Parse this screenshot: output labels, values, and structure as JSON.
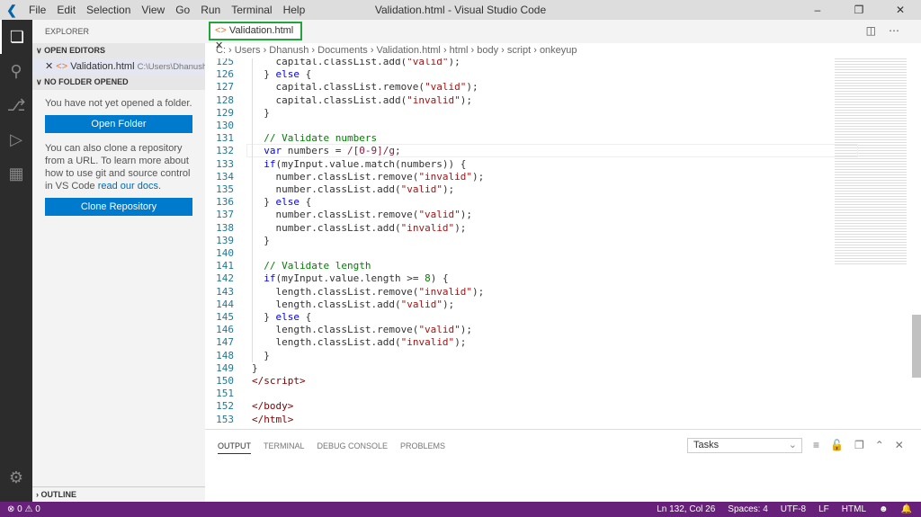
{
  "titlebar": {
    "menu": [
      "File",
      "Edit",
      "Selection",
      "View",
      "Go",
      "Run",
      "Terminal",
      "Help"
    ],
    "title": "Validation.html - Visual Studio Code"
  },
  "sidebar": {
    "header": "EXPLORER",
    "open_editors": "OPEN EDITORS",
    "open_file": "Validation.html",
    "open_file_path": "C:\\Users\\Dhanush\\...",
    "no_folder": "NO FOLDER OPENED",
    "msg1": "You have not yet opened a folder.",
    "open_folder": "Open Folder",
    "msg2": "You can also clone a repository from a URL. To learn more about how to use git and source control in VS Code ",
    "docs_link": "read our docs",
    "msg2_end": ".",
    "clone": "Clone Repository",
    "outline": "OUTLINE"
  },
  "tab": {
    "label": "Validation.html"
  },
  "breadcrumbs": [
    "C:",
    "Users",
    "Dhanush",
    "Documents",
    "Validation.html",
    "html",
    "body",
    "script",
    "onkeyup"
  ],
  "code": {
    "current_line": 132,
    "lines": [
      [
        125,
        [
          [
            "",
            "    capital.classList.add("
          ],
          [
            "s",
            "\"valid\""
          ],
          [
            "",
            ");"
          ]
        ]
      ],
      [
        126,
        [
          [
            "",
            "  } "
          ],
          [
            "k",
            "else"
          ],
          [
            "",
            " {"
          ]
        ]
      ],
      [
        127,
        [
          [
            "",
            "    capital.classList.remove("
          ],
          [
            "s",
            "\"valid\""
          ],
          [
            "",
            ");"
          ]
        ]
      ],
      [
        128,
        [
          [
            "",
            "    capital.classList.add("
          ],
          [
            "s",
            "\"invalid\""
          ],
          [
            "",
            ");"
          ]
        ]
      ],
      [
        129,
        [
          [
            "",
            "  }"
          ]
        ]
      ],
      [
        130,
        []
      ],
      [
        131,
        [
          [
            "c",
            "  // Validate numbers"
          ]
        ]
      ],
      [
        132,
        [
          [
            "k",
            "  var"
          ],
          [
            "",
            " numbers = "
          ],
          [
            "r",
            "/[0-9]/g"
          ],
          [
            "",
            ";"
          ]
        ]
      ],
      [
        133,
        [
          [
            "k",
            "  if"
          ],
          [
            "",
            "(myInput.value.match(numbers)) {"
          ]
        ]
      ],
      [
        134,
        [
          [
            "",
            "    number.classList.remove("
          ],
          [
            "s",
            "\"invalid\""
          ],
          [
            "",
            ");"
          ]
        ]
      ],
      [
        135,
        [
          [
            "",
            "    number.classList.add("
          ],
          [
            "s",
            "\"valid\""
          ],
          [
            "",
            ");"
          ]
        ]
      ],
      [
        136,
        [
          [
            "",
            "  } "
          ],
          [
            "k",
            "else"
          ],
          [
            "",
            " {"
          ]
        ]
      ],
      [
        137,
        [
          [
            "",
            "    number.classList.remove("
          ],
          [
            "s",
            "\"valid\""
          ],
          [
            "",
            ");"
          ]
        ]
      ],
      [
        138,
        [
          [
            "",
            "    number.classList.add("
          ],
          [
            "s",
            "\"invalid\""
          ],
          [
            "",
            ");"
          ]
        ]
      ],
      [
        139,
        [
          [
            "",
            "  }"
          ]
        ]
      ],
      [
        140,
        []
      ],
      [
        141,
        [
          [
            "c",
            "  // Validate length"
          ]
        ]
      ],
      [
        142,
        [
          [
            "k",
            "  if"
          ],
          [
            "",
            "(myInput.value.length >= "
          ],
          [
            "c",
            "8"
          ],
          [
            "",
            ") {"
          ]
        ]
      ],
      [
        143,
        [
          [
            "",
            "    length.classList.remove("
          ],
          [
            "s",
            "\"invalid\""
          ],
          [
            "",
            ");"
          ]
        ]
      ],
      [
        144,
        [
          [
            "",
            "    length.classList.add("
          ],
          [
            "s",
            "\"valid\""
          ],
          [
            "",
            ");"
          ]
        ]
      ],
      [
        145,
        [
          [
            "",
            "  } "
          ],
          [
            "k",
            "else"
          ],
          [
            "",
            " {"
          ]
        ]
      ],
      [
        146,
        [
          [
            "",
            "    length.classList.remove("
          ],
          [
            "s",
            "\"valid\""
          ],
          [
            "",
            ");"
          ]
        ]
      ],
      [
        147,
        [
          [
            "",
            "    length.classList.add("
          ],
          [
            "s",
            "\"invalid\""
          ],
          [
            "",
            ");"
          ]
        ]
      ],
      [
        148,
        [
          [
            "",
            "  }"
          ]
        ]
      ],
      [
        149,
        [
          [
            "",
            "}"
          ]
        ]
      ],
      [
        150,
        [
          [
            "t",
            "</script>"
          ]
        ]
      ],
      [
        151,
        []
      ],
      [
        152,
        [
          [
            "t",
            "</body>"
          ]
        ]
      ],
      [
        153,
        [
          [
            "t",
            "</html>"
          ]
        ]
      ]
    ]
  },
  "panel": {
    "tabs": [
      "OUTPUT",
      "TERMINAL",
      "DEBUG CONSOLE",
      "PROBLEMS"
    ],
    "task_select": "Tasks"
  },
  "status": {
    "errors": "0",
    "warnings": "0",
    "position": "Ln 132, Col 26",
    "spaces": "Spaces: 4",
    "encoding": "UTF-8",
    "eol": "LF",
    "language": "HTML"
  }
}
